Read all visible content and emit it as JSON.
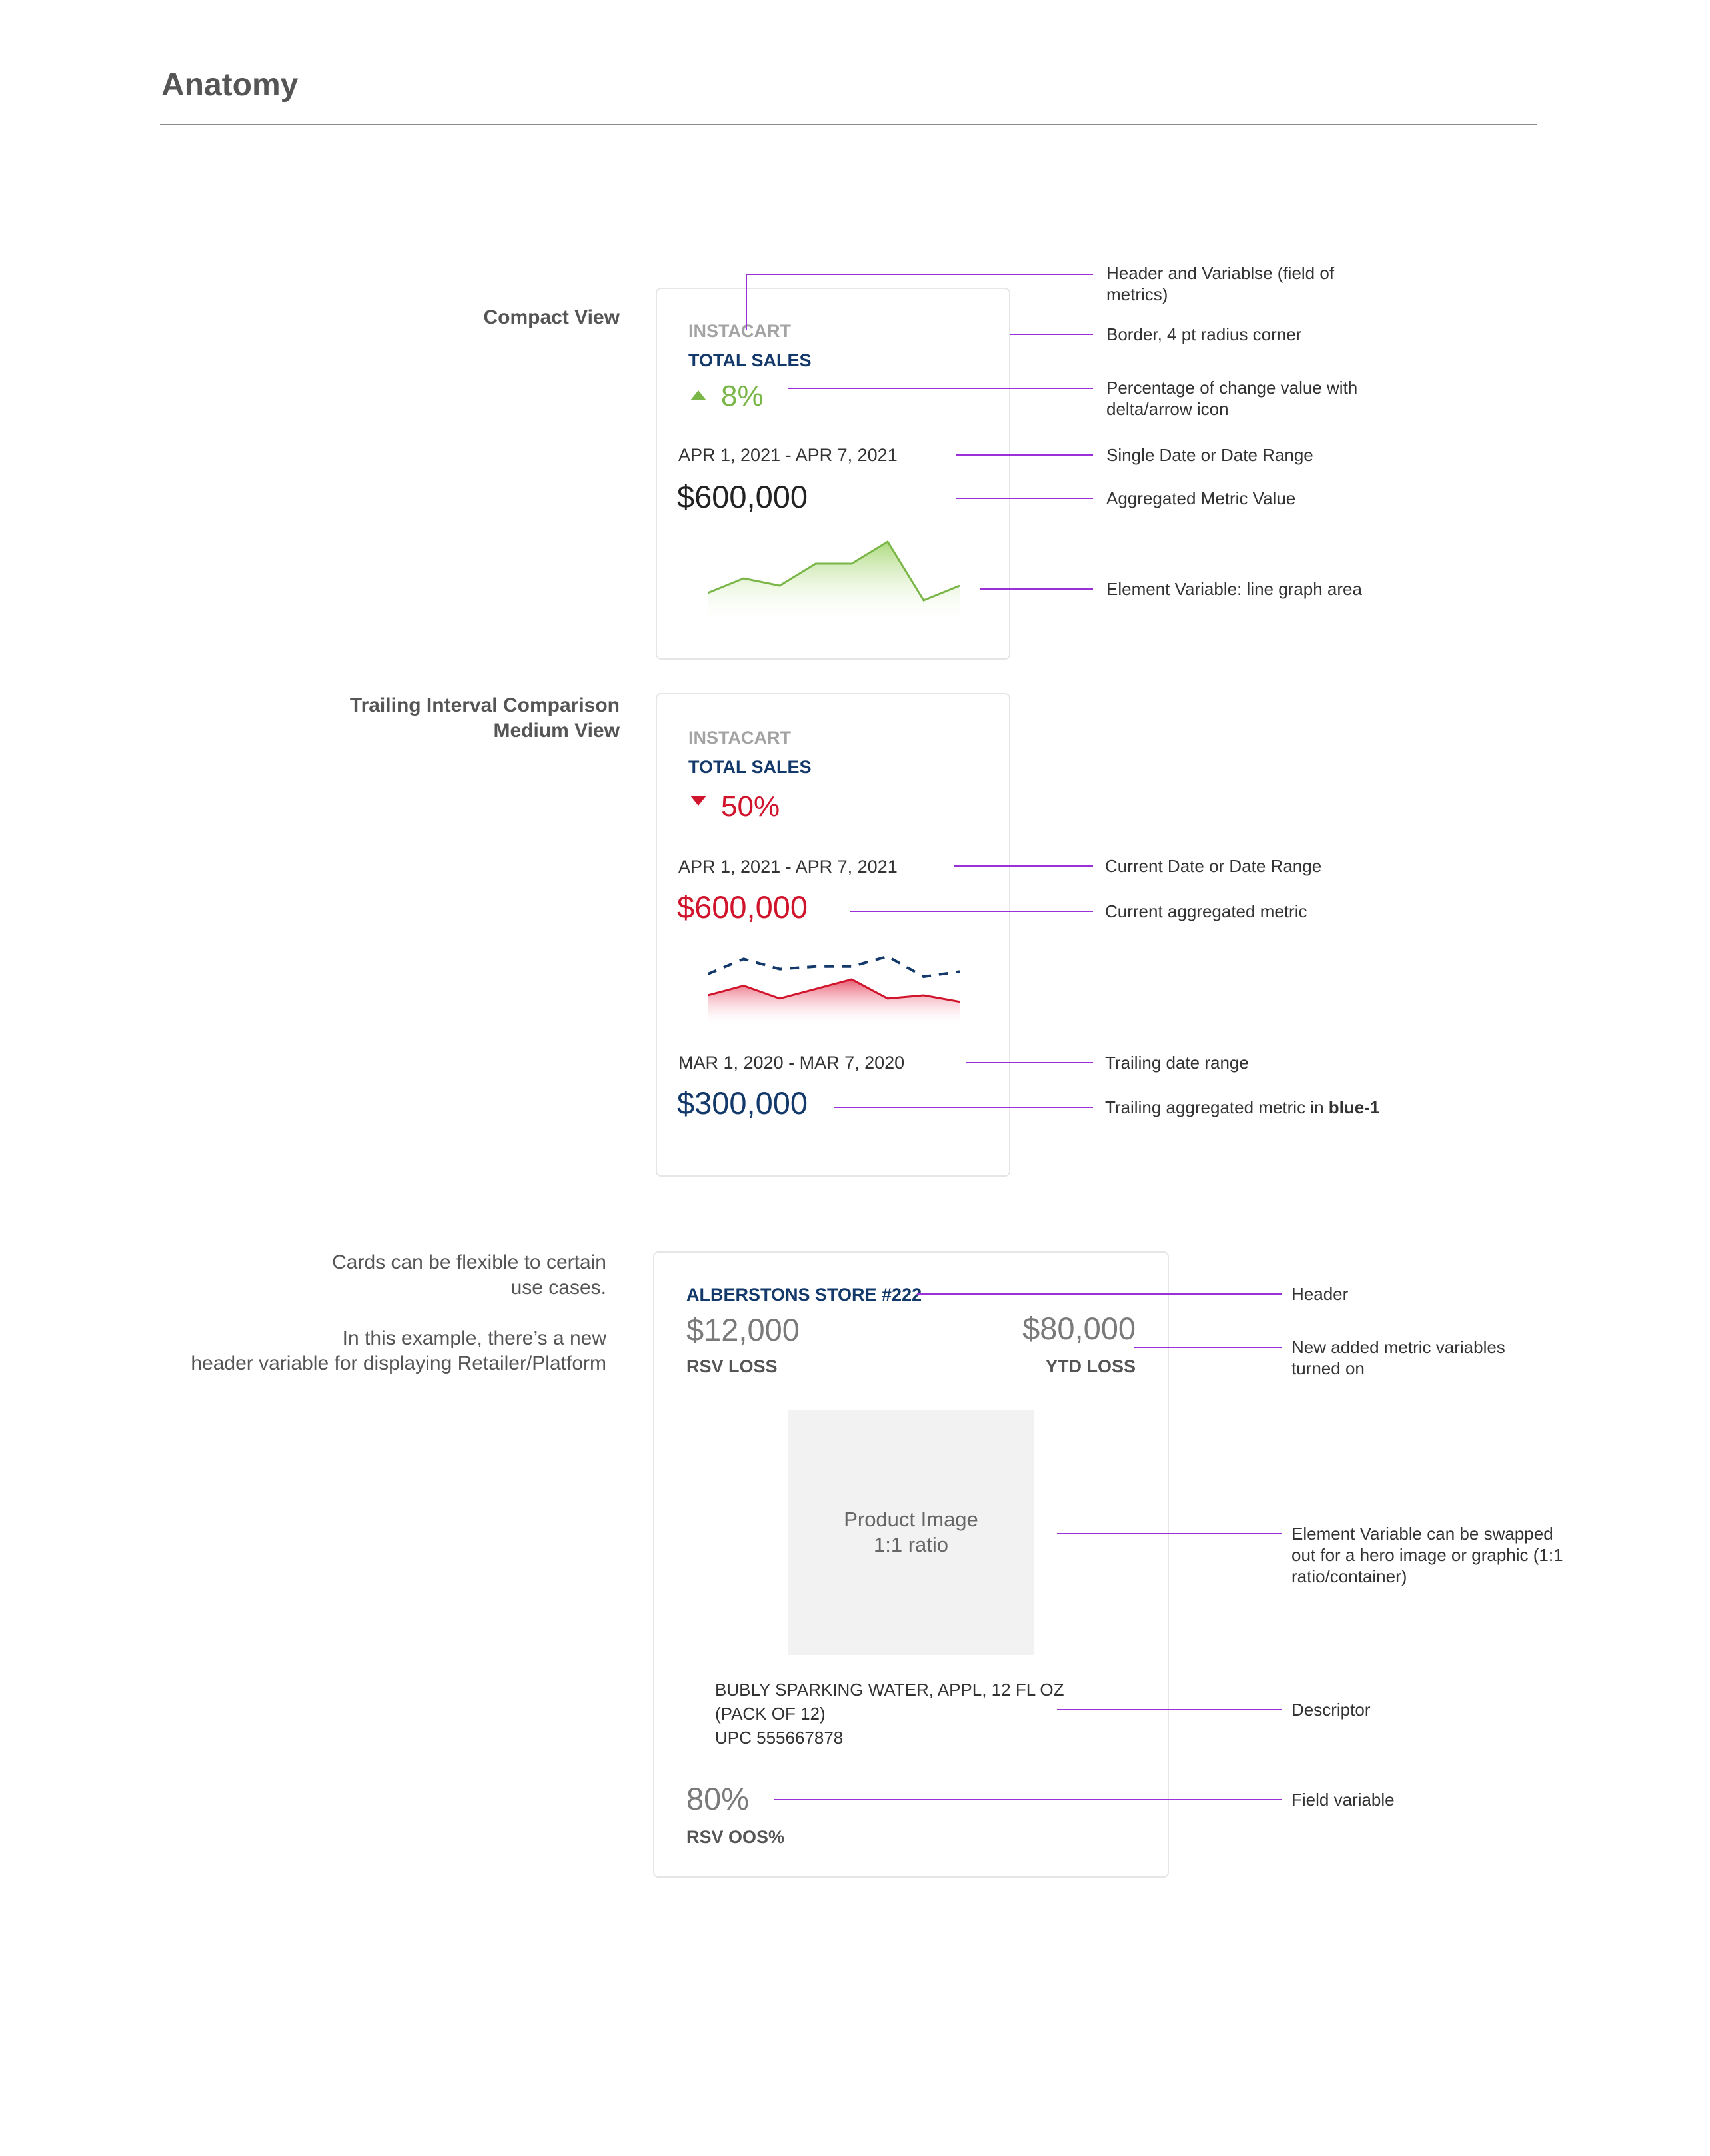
{
  "page": {
    "title": "Anatomy"
  },
  "colors": {
    "accent_line": "#9b30d9",
    "green": "#7ab648",
    "red": "#d0142c",
    "navy": "#13396b",
    "gray_label": "#a3a3a3"
  },
  "compact": {
    "section_label": "Compact View",
    "retailer": "INSTACART",
    "metric_name": "TOTAL SALES",
    "change_icon": "triangle-up-icon",
    "change_pct": "8%",
    "date_range": "APR 1, 2021 - APR 7, 2021",
    "value": "$600,000",
    "chart_data": {
      "type": "area",
      "series": [
        {
          "values": [
            2,
            4,
            3,
            6,
            6,
            9,
            1,
            3
          ]
        }
      ],
      "ylim": [
        0,
        10
      ]
    },
    "annotations": {
      "header": "Header and Variablse (field of metrics)",
      "border": "Border, 4 pt radius corner",
      "pct": "Percentage of change value with delta/arrow icon",
      "date": "Single Date or Date Range",
      "value": "Aggregated Metric Value",
      "graph": "Element Variable: line graph area"
    }
  },
  "medium": {
    "section_label_1": "Trailing Interval Comparison",
    "section_label_2": "Medium View",
    "retailer": "INSTACART",
    "metric_name": "TOTAL SALES",
    "change_icon": "triangle-down-icon",
    "change_pct": "50%",
    "current_date_range": "APR 1, 2021 - APR 7, 2021",
    "current_value": "$600,000",
    "trailing_date_range": "MAR 1, 2020 - MAR 7, 2020",
    "trailing_value": "$300,000",
    "chart_data": {
      "type": "area",
      "series": [
        {
          "values": [
            5,
            8,
            4,
            7,
            10,
            4,
            5,
            3
          ]
        },
        {
          "values": [
            1,
            7,
            3,
            4,
            4,
            8,
            0,
            2
          ],
          "style": "dashed"
        }
      ],
      "ylim": [
        0,
        10
      ]
    },
    "annotations": {
      "current_date": "Current Date or Date Range",
      "current_value": "Current aggregated metric",
      "trailing_date": "Trailing date range",
      "trailing_value_prefix": "Trailing aggregated metric in ",
      "trailing_value_bold": "blue-1"
    }
  },
  "flex": {
    "note_1_line_1": "Cards can be flexible to certain",
    "note_1_line_2": "use cases.",
    "note_2_line_1": "In this example, there’s a new",
    "note_2_line_2": "header variable for displaying Retailer/Platform",
    "header": "ALBERSTONS STORE #222",
    "metric_left_value": "$12,000",
    "metric_left_label": "RSV LOSS",
    "metric_right_value": "$80,000",
    "metric_right_label": "YTD LOSS",
    "image_line_1": "Product Image",
    "image_line_2": "1:1 ratio",
    "desc_line_1": "BUBLY SPARKING WATER, APPL, 12 FL OZ",
    "desc_line_2": "(PACK OF 12)",
    "desc_line_3": "UPC 555667878",
    "field_value": "80%",
    "field_label": "RSV OOS%",
    "annotations": {
      "header": "Header",
      "new_metrics": "New added metric variables turned on",
      "element": "Element Variable can be swapped out for a hero image or graphic (1:1 ratio/container)",
      "descriptor": "Descriptor",
      "field": "Field variable"
    }
  }
}
